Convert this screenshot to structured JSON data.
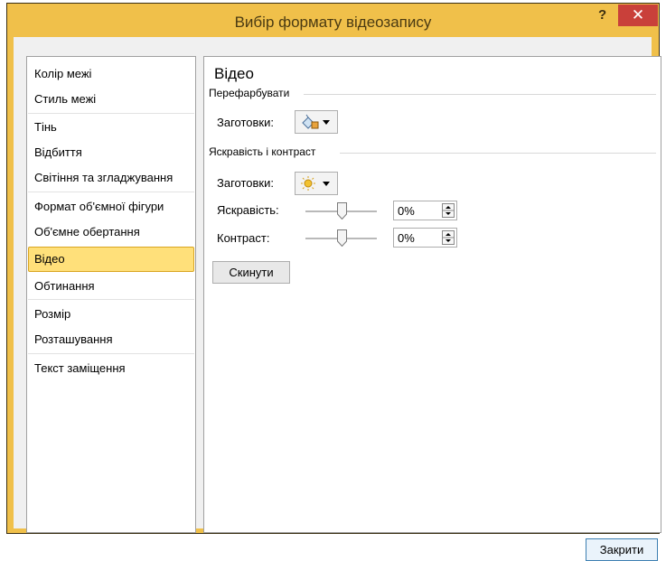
{
  "window": {
    "title": "Вибір формату відеозапису",
    "help": "?",
    "close": "✕"
  },
  "sidebar": {
    "items": [
      {
        "label": "Колір межі"
      },
      {
        "label": "Стиль межі"
      },
      {
        "label": "Тінь"
      },
      {
        "label": "Відбиття"
      },
      {
        "label": "Світіння та згладжування"
      },
      {
        "label": "Формат об'ємної фігури"
      },
      {
        "label": "Об'ємне обертання"
      },
      {
        "label": "Відео"
      },
      {
        "label": "Обтинання"
      },
      {
        "label": "Розмір"
      },
      {
        "label": "Розташування"
      },
      {
        "label": "Текст заміщення"
      }
    ],
    "selected": "Відео"
  },
  "panel": {
    "title": "Відео",
    "recolor": {
      "section": "Перефарбувати",
      "presets_label": "Заготовки:",
      "icon": "paint-bucket-icon"
    },
    "brightness_contrast": {
      "section": "Яскравість і контраст",
      "presets_label": "Заготовки:",
      "icon": "sun-icon",
      "brightness": {
        "label": "Яскравість:",
        "value": "0%",
        "slider": 0.5
      },
      "contrast": {
        "label": "Контраст:",
        "value": "0%",
        "slider": 0.5
      }
    },
    "reset_label": "Скинути"
  },
  "footer": {
    "close_label": "Закрити"
  },
  "colors": {
    "frame": "#f0c04a",
    "selection": "#ffe07a",
    "close_button": "#c9403a"
  }
}
